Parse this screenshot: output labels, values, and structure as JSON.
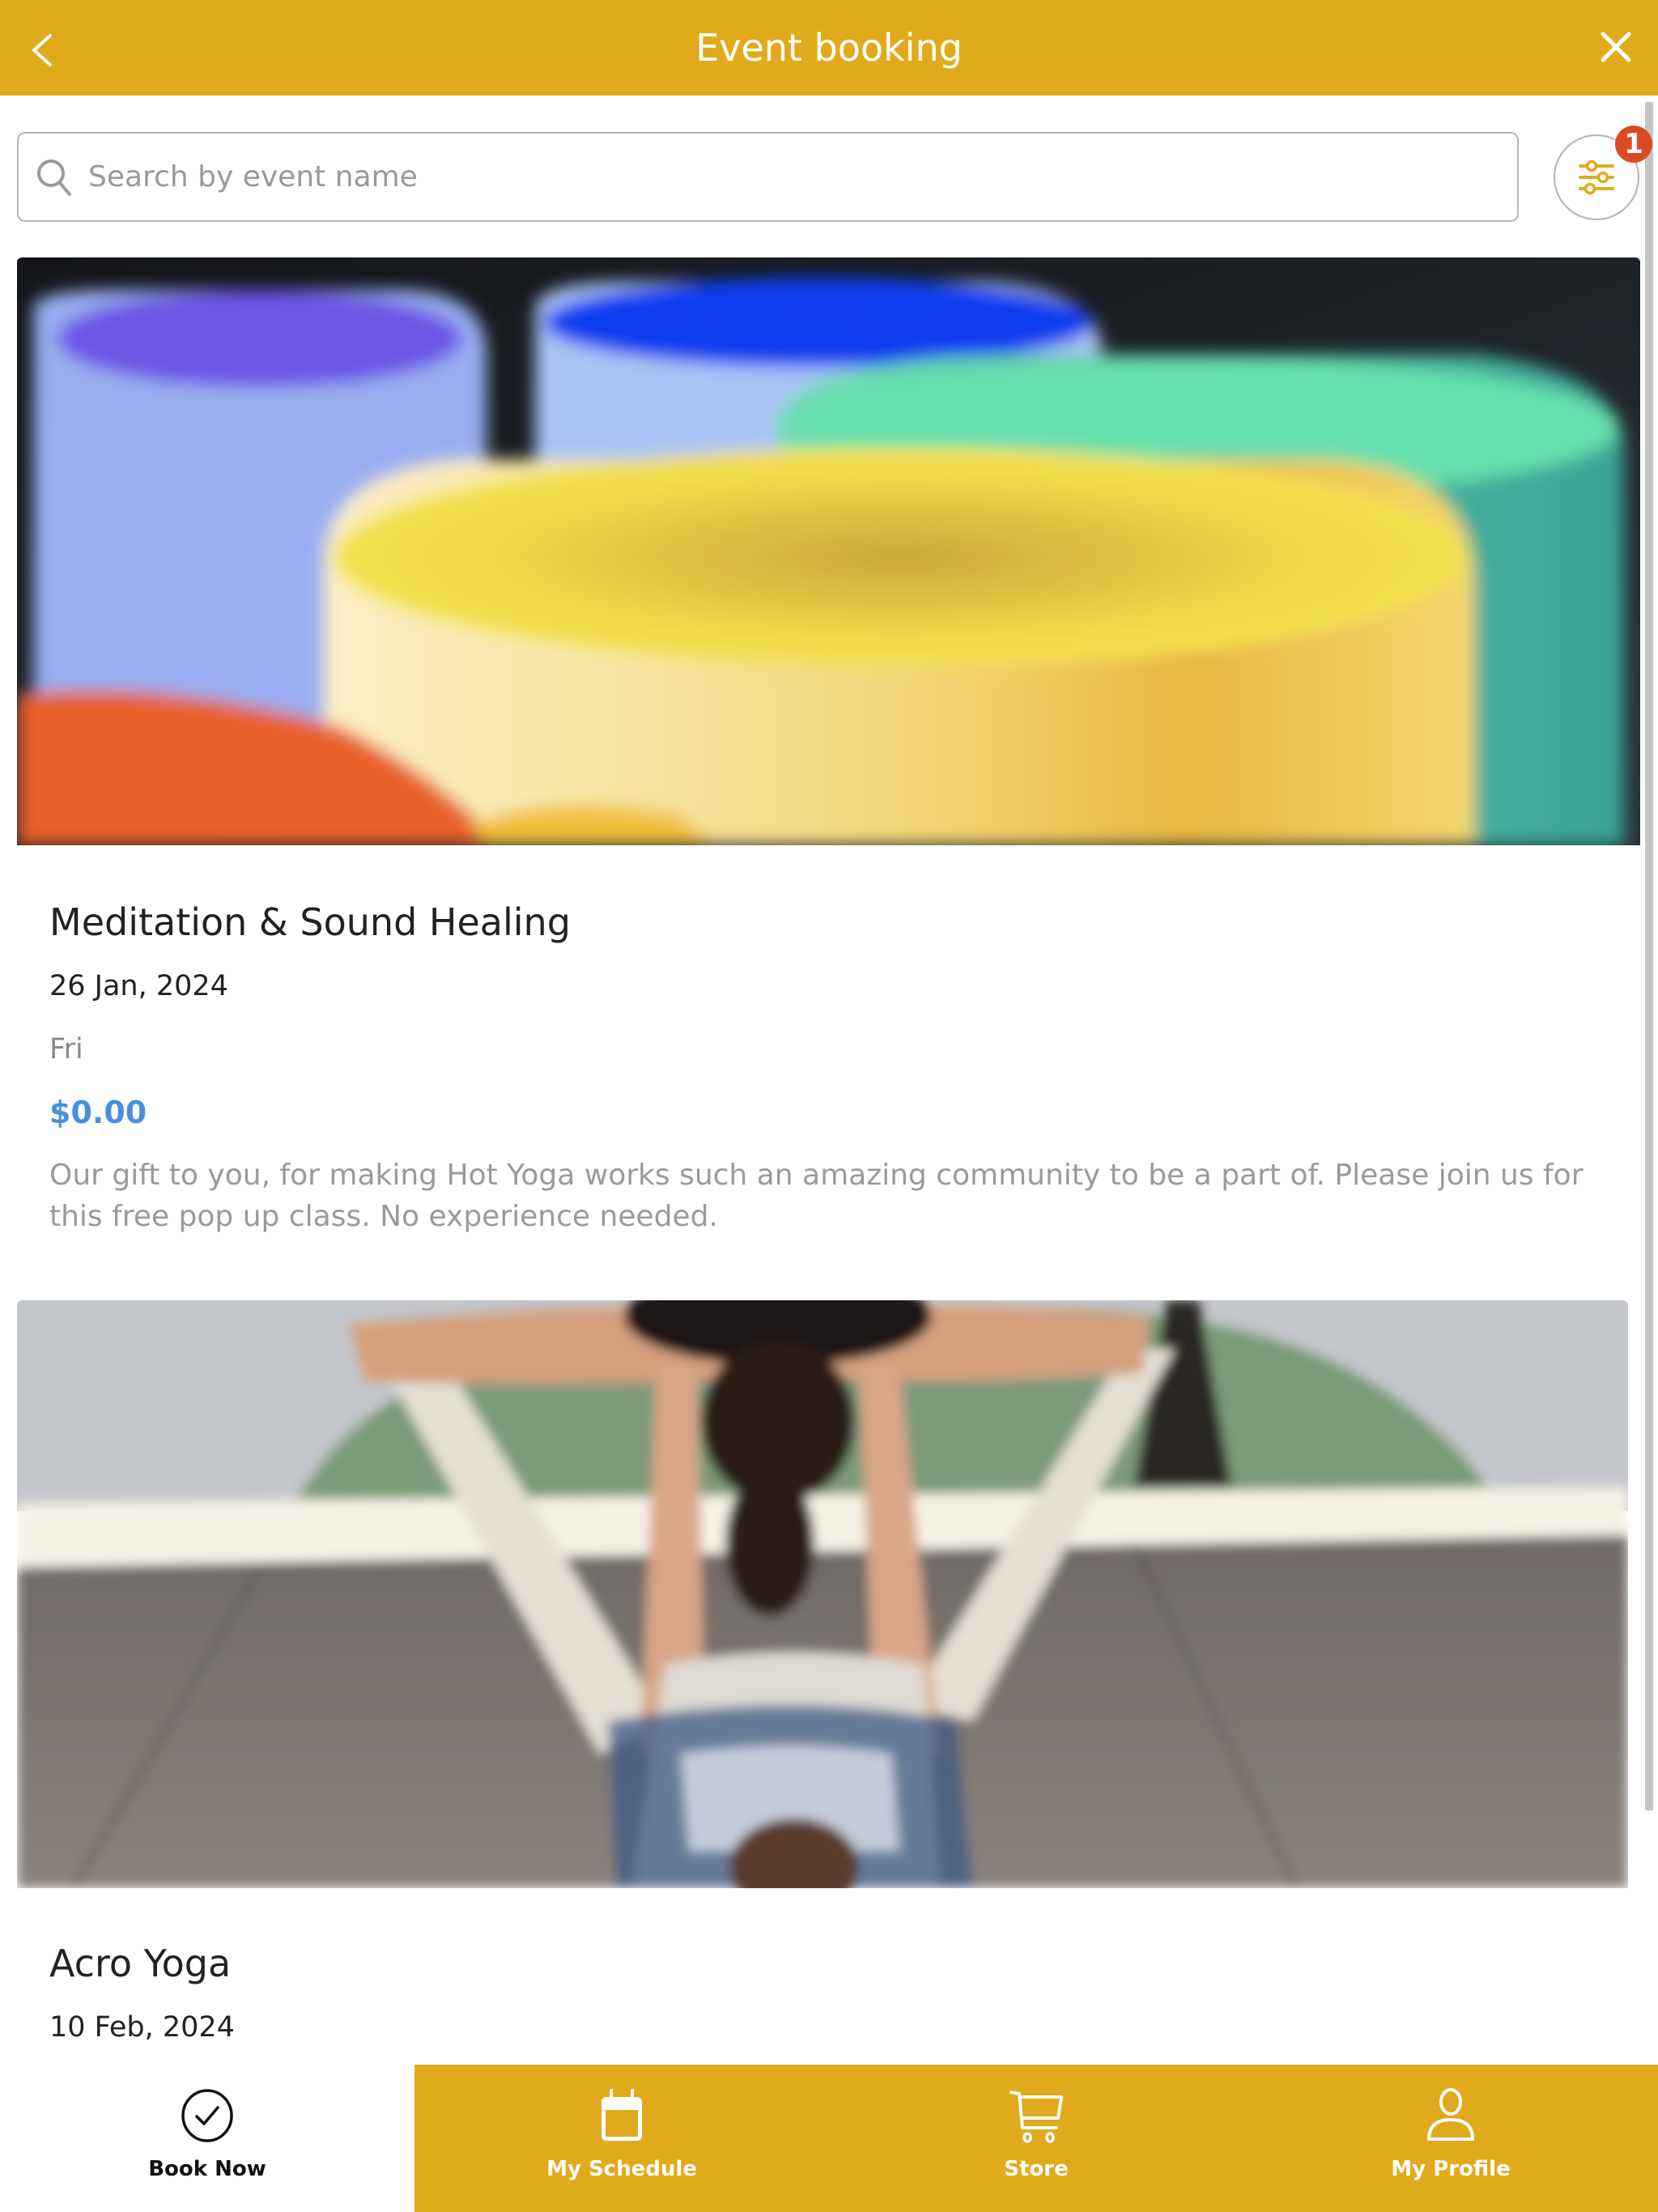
{
  "header": {
    "title": "Event booking",
    "back_icon": "chevron-left-icon",
    "close_icon": "close-icon"
  },
  "search": {
    "placeholder": "Search by event name",
    "value": "",
    "icon": "search-icon"
  },
  "filter": {
    "icon": "sliders-icon",
    "badge_count": "1"
  },
  "colors": {
    "brand": "#e1aa1c",
    "badge": "#d84b24",
    "price": "#4a8fdb",
    "description": "#9a9a9a"
  },
  "events": [
    {
      "title": "Meditation & Sound Healing",
      "date": "26 Jan, 2024",
      "day": "Fri",
      "price": "$0.00",
      "description": "Our gift to you, for making Hot Yoga works such an amazing community to be a part of. Please join us for this free pop up class. No experience needed.",
      "image": "colorful-crystal-singing-bowls-photo"
    },
    {
      "title": "Acro Yoga",
      "date": "10 Feb, 2024",
      "image": "acro-yoga-partners-photo"
    }
  ],
  "bottom_nav": {
    "items": [
      {
        "label": "Book Now",
        "icon": "check-circle-icon",
        "active": true
      },
      {
        "label": "My Schedule",
        "icon": "calendar-icon",
        "active": false
      },
      {
        "label": "Store",
        "icon": "cart-icon",
        "active": false
      },
      {
        "label": "My Profile",
        "icon": "user-icon",
        "active": false
      }
    ]
  }
}
